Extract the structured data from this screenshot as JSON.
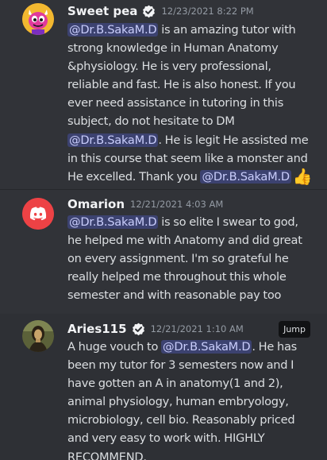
{
  "messages": [
    {
      "username": "Sweet pea",
      "timestamp": "12/23/2021 8:22 PM",
      "lines": [
        [
          {
            "t": "mention",
            "v": "@Dr.B.SakaM.D"
          },
          {
            "t": "text",
            "v": " is an amazing tutor with"
          }
        ],
        [
          {
            "t": "text",
            "v": "strong knowledge in Human Anatomy"
          }
        ],
        [
          {
            "t": "text",
            "v": "&physiology. He  is very professional,"
          }
        ],
        [
          {
            "t": "text",
            "v": "reliable and fast. He is also honest. If you"
          }
        ],
        [
          {
            "t": "text",
            "v": "ever need assistance in tutoring in this"
          }
        ],
        [
          {
            "t": "text",
            "v": "subject, do not hesitate to DM"
          }
        ],
        [
          {
            "t": "mention",
            "v": "@Dr.B.SakaM.D"
          },
          {
            "t": "text",
            "v": ". He is legit He assisted me"
          }
        ],
        [
          {
            "t": "text",
            "v": "in this course that seem like a monster and"
          }
        ],
        [
          {
            "t": "text",
            "v": "He excelled. Thank you "
          },
          {
            "t": "mention",
            "v": "@Dr.B.SakaM.D"
          },
          {
            "t": "emoji",
            "v": "👍"
          }
        ]
      ]
    },
    {
      "username": "Omarion",
      "timestamp": "12/21/2021 4:03 AM",
      "lines": [
        [
          {
            "t": "mention",
            "v": "@Dr.B.SakaM.D"
          },
          {
            "t": "text",
            "v": "  is so elite I swear to god,"
          }
        ],
        [
          {
            "t": "text",
            "v": "he helped me with Anatomy and did great"
          }
        ],
        [
          {
            "t": "text",
            "v": "on every assignment. I'm so grateful he"
          }
        ],
        [
          {
            "t": "text",
            "v": "really helped me throughout this whole"
          }
        ],
        [
          {
            "t": "text",
            "v": "semester and with reasonable pay too"
          }
        ]
      ]
    },
    {
      "username": "Aries115",
      "timestamp": "12/21/2021 1:10 AM",
      "jump_label": "Jump",
      "lines": [
        [
          {
            "t": "text",
            "v": "A huge vouch to "
          },
          {
            "t": "mention",
            "v": "@Dr.B.SakaM.D"
          },
          {
            "t": "text",
            "v": ". He has"
          }
        ],
        [
          {
            "t": "text",
            "v": "been my tutor for 3 semesters now and I"
          }
        ],
        [
          {
            "t": "text",
            "v": "have gotten an A in anatomy(1 and 2),"
          }
        ],
        [
          {
            "t": "text",
            "v": "animal physiology, human embryology,"
          }
        ],
        [
          {
            "t": "text",
            "v": "microbiology, cell bio. Reasonably priced"
          }
        ],
        [
          {
            "t": "text",
            "v": "and very easy to work with. HIGHLY"
          }
        ],
        [
          {
            "t": "text",
            "v": "RECOMMEND."
          }
        ]
      ]
    }
  ],
  "icons": {
    "verified": "verified-check-icon",
    "avatar1": "pink-devil-avatar-icon",
    "avatar2": "discord-logo-avatar-icon",
    "avatar3": "mona-lisa-avatar-icon"
  },
  "colors": {
    "background": "#313338",
    "hover": "#2e3035",
    "mention_bg": "#3c4270",
    "mention_fg": "#c9cdfb",
    "discord_red": "#ed4245"
  }
}
